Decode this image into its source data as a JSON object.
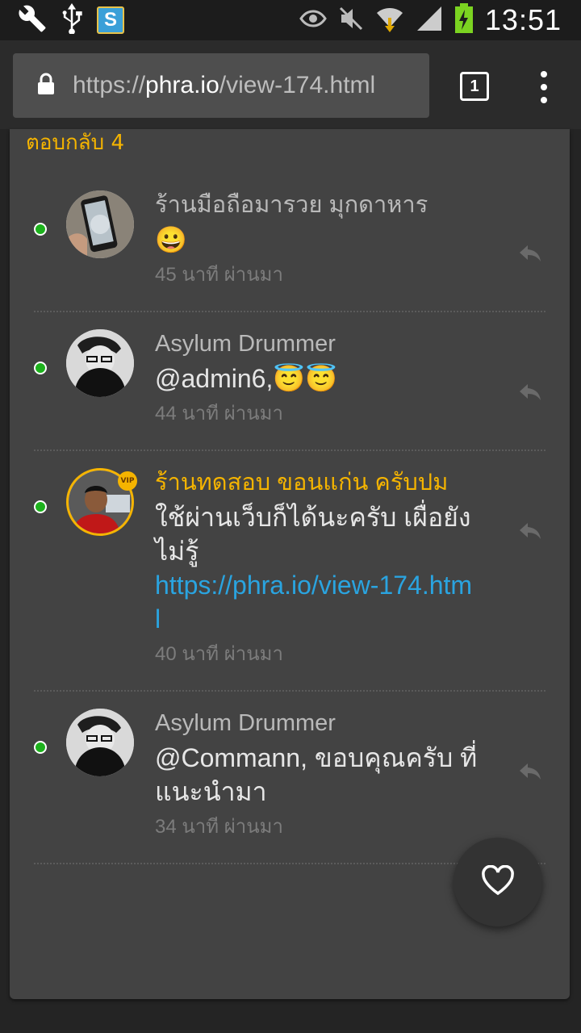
{
  "status_bar": {
    "time": "13:51",
    "left_icons": [
      "wrench-icon",
      "usb-icon",
      "s-app-icon"
    ],
    "app_letter": "S",
    "right_icons": [
      "eye-icon",
      "mute-icon",
      "wifi-icon",
      "signal-icon",
      "battery-charging-icon"
    ]
  },
  "browser": {
    "url_scheme": "https://",
    "url_host": "phra.io",
    "url_path": "/view-174.html",
    "tab_count": "1"
  },
  "section": {
    "title": "ตอบกลับ 4"
  },
  "comments": [
    {
      "name": "ร้านมือถือมารวย มุกดาหาร",
      "message": "😀",
      "time": "45 นาที ผ่านมา",
      "vip": false
    },
    {
      "name": "Asylum Drummer",
      "message": "@admin6,😇😇",
      "time": "44 นาที ผ่านมา",
      "vip": false
    },
    {
      "name": "ร้านทดสอบ ขอนแก่น ครับปม",
      "message": "ใช้ผ่านเว็บก็ได้นะครับ เผื่อยังไม่รู้",
      "link": "https://phra.io/view-174.html",
      "time": "40 นาที ผ่านมา",
      "vip": true,
      "badge": "VIP"
    },
    {
      "name": "Asylum Drummer",
      "message": "@Commann, ขอบคุณครับ ที่แนะนำมา",
      "time": "34 นาที ผ่านมา",
      "vip": false
    }
  ],
  "colors": {
    "accent": "#f5b400",
    "link": "#2aa4e0",
    "online": "#1db21d",
    "card": "#434343"
  }
}
